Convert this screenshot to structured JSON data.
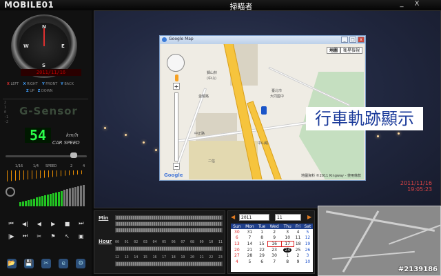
{
  "titlebar": {
    "brand": "MOBILE01",
    "title": "掃瞄者",
    "minimize": "_",
    "close": "X"
  },
  "left_panel": {
    "compass": {
      "n": "N",
      "e": "E",
      "s": "S",
      "w": "W"
    },
    "led_text": "2011/11/16",
    "dirs": {
      "x": "X",
      "left": "LEFT",
      "right": "RIGHT",
      "y": "Y",
      "front": "FRONT",
      "back": "BACK",
      "z": "Z",
      "up": "UP",
      "down": "DOWN"
    },
    "gsensor_title": "G-Sensor",
    "speed_value": "54",
    "speed_unit": "km/h",
    "speed_caption": "CAR SPEED",
    "speed_scale": {
      "a": "1/16",
      "b": "1/4",
      "label": "SPEED",
      "c": "2",
      "d": "4"
    },
    "transport": [
      "⏮",
      "◀|",
      "◀",
      "▶",
      "■",
      "⏭"
    ],
    "transport2": [
      "|▶",
      "⏭",
      "✂",
      "⚑",
      "↖",
      "▣"
    ],
    "icons": [
      "📂",
      "💾",
      "✂",
      "e",
      "⚙"
    ]
  },
  "video": {
    "timestamp_date": "2011/11/16",
    "timestamp_time": "19:05:23"
  },
  "gmap": {
    "title": "Google Map",
    "map_btn": "地圖",
    "satellite_btn": "衛星檢視",
    "zoom_in": "+",
    "zoom_out": "−",
    "copyright": "地圖資料 ©2011 Kingway - 使用條款",
    "logo": "Google",
    "labels": {
      "hill": "獅山林",
      "hill2": "(中山)",
      "street1": "金龍路",
      "street2": "中正路",
      "street3": "臺北市",
      "school": "大同國中",
      "park": "二信",
      "road": "中山路"
    }
  },
  "caption": "行車軌跡顯示",
  "timeline": {
    "min_label": "Min",
    "hour_label": "Hour",
    "hours_row1": [
      "00",
      "01",
      "02",
      "03",
      "04",
      "05",
      "06",
      "07",
      "08",
      "09",
      "10",
      "11"
    ],
    "hours_row2": [
      "12",
      "13",
      "14",
      "15",
      "16",
      "17",
      "18",
      "19",
      "20",
      "21",
      "22",
      "23"
    ]
  },
  "calendar": {
    "year": "2011",
    "month": "11",
    "weekdays": [
      "Sun",
      "Mon",
      "Tue",
      "Wed",
      "Thu",
      "Fri",
      "Sat"
    ],
    "weeks": [
      [
        "30",
        "31",
        "1",
        "2",
        "3",
        "4",
        "5"
      ],
      [
        "6",
        "7",
        "8",
        "9",
        "10",
        "11",
        "12"
      ],
      [
        "13",
        "14",
        "15",
        "16",
        "17",
        "18",
        "19"
      ],
      [
        "20",
        "21",
        "22",
        "23",
        "24",
        "25",
        "26"
      ],
      [
        "27",
        "28",
        "29",
        "30",
        "1",
        "2",
        "3"
      ],
      [
        "4",
        "5",
        "6",
        "7",
        "8",
        "9",
        "10"
      ]
    ]
  },
  "minimap": {
    "watermark": "#2139186"
  },
  "colors": {
    "accent_orange": "#e07a20",
    "speed_green": "#2aff4a",
    "timestamp_red": "#dd4444"
  }
}
